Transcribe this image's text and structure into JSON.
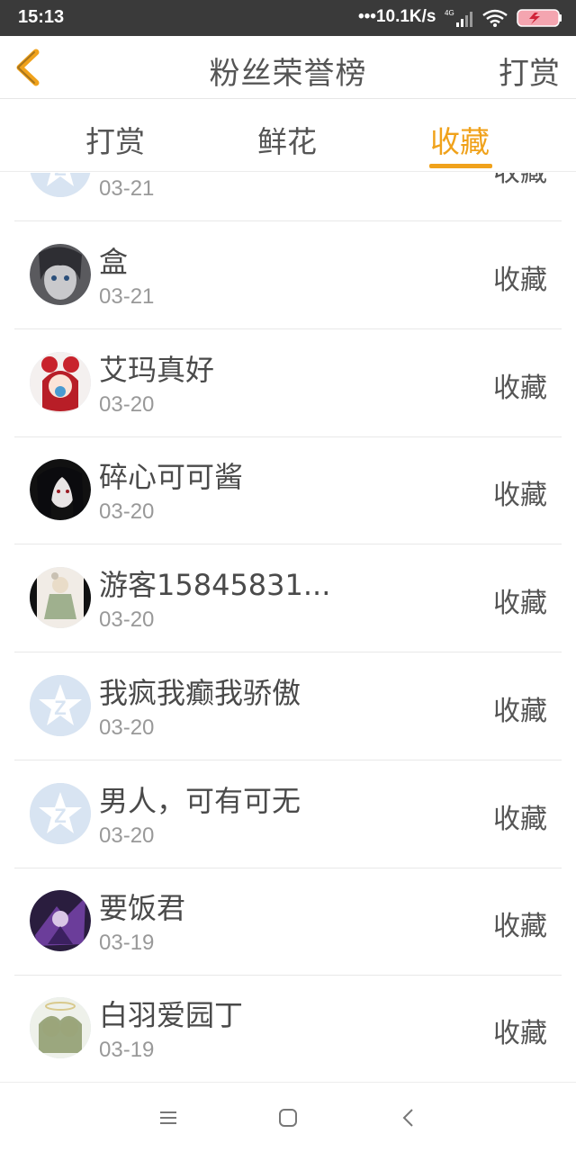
{
  "status": {
    "time": "15:13",
    "network_speed": "•••10.1K/s",
    "signal_label": "4G"
  },
  "nav": {
    "title": "粉丝荣誉榜",
    "right_action": "打赏"
  },
  "tabs": [
    {
      "label": "打赏",
      "active": false
    },
    {
      "label": "鲜花",
      "active": false
    },
    {
      "label": "收藏",
      "active": true
    }
  ],
  "accent_color": "#f0a21b",
  "list": [
    {
      "name": "",
      "date": "03-21",
      "action": "收藏",
      "avatar": "default-avatar"
    },
    {
      "name": "盒",
      "date": "03-21",
      "action": "收藏",
      "avatar": "user-avatar"
    },
    {
      "name": "艾玛真好",
      "date": "03-20",
      "action": "收藏",
      "avatar": "user-avatar"
    },
    {
      "name": "碎心可可酱",
      "date": "03-20",
      "action": "收藏",
      "avatar": "user-avatar"
    },
    {
      "name": "游客15845831...",
      "date": "03-20",
      "action": "收藏",
      "avatar": "user-avatar"
    },
    {
      "name": "我疯我癫我骄傲",
      "date": "03-20",
      "action": "收藏",
      "avatar": "default-avatar"
    },
    {
      "name": "男人，可有可无",
      "date": "03-20",
      "action": "收藏",
      "avatar": "default-avatar"
    },
    {
      "name": "要饭君",
      "date": "03-19",
      "action": "收藏",
      "avatar": "user-avatar"
    },
    {
      "name": "白羽爱园丁",
      "date": "03-19",
      "action": "收藏",
      "avatar": "user-avatar"
    }
  ]
}
